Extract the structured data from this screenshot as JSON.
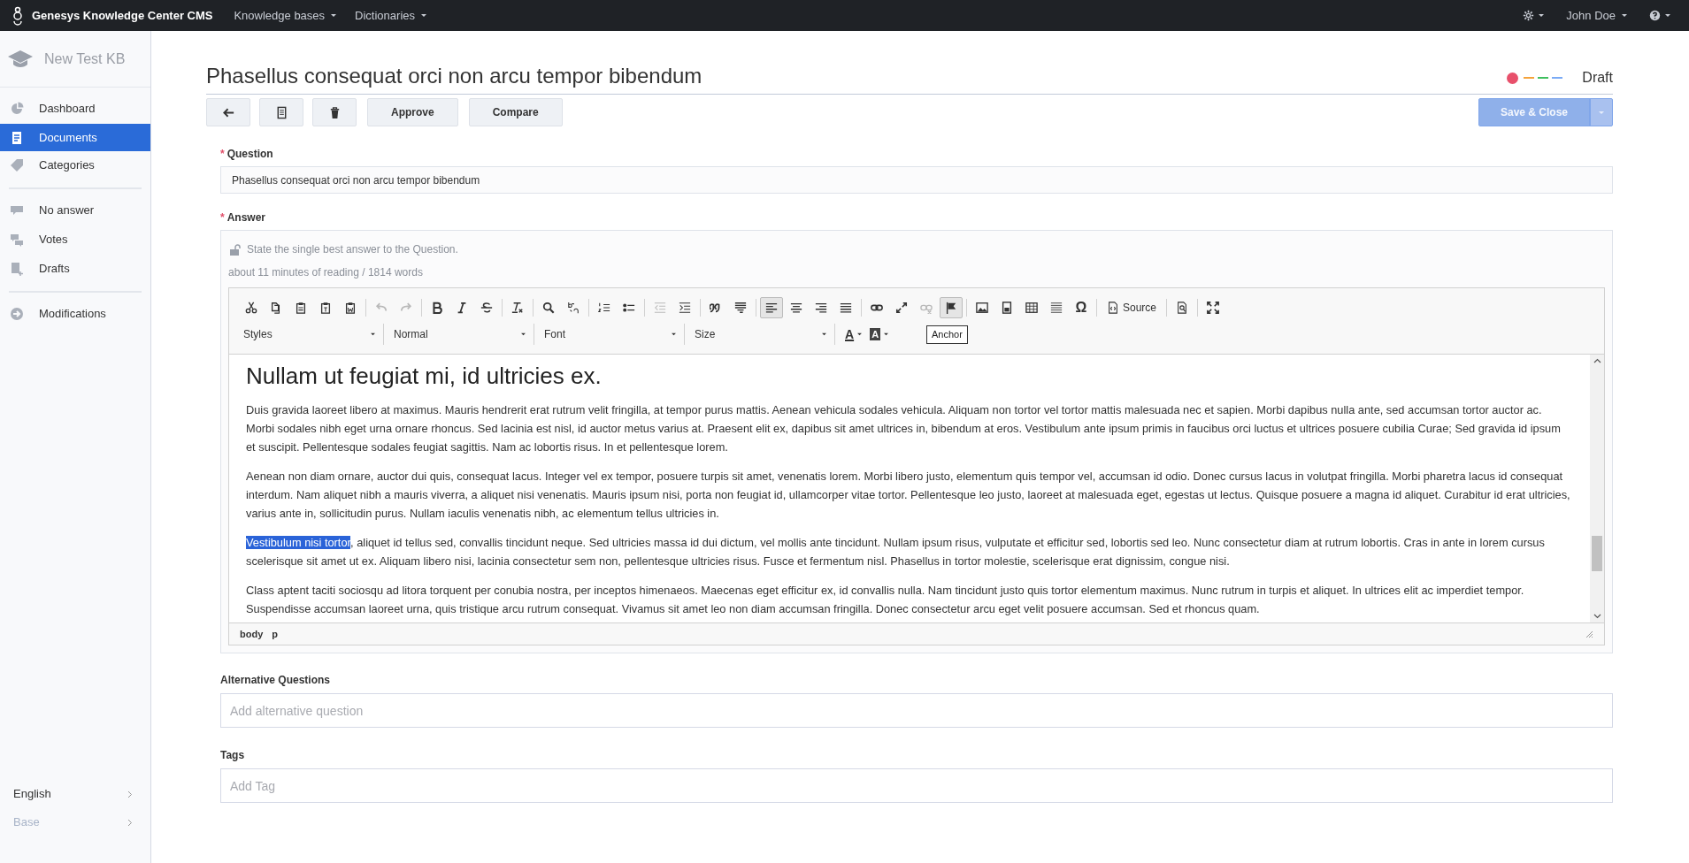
{
  "top_bar": {
    "app_title": "Genesys Knowledge Center CMS",
    "menus": [
      "Knowledge bases",
      "Dictionaries"
    ],
    "user": "John Doe"
  },
  "sidebar": {
    "kb_name": "New Test KB",
    "groups": [
      [
        {
          "label": "Dashboard",
          "selected": false
        },
        {
          "label": "Documents",
          "selected": true
        },
        {
          "label": "Categories",
          "selected": false
        }
      ],
      [
        {
          "label": "No answer",
          "selected": false
        },
        {
          "label": "Votes",
          "selected": false
        },
        {
          "label": "Drafts",
          "selected": false
        }
      ],
      [
        {
          "label": "Modifications",
          "selected": false
        }
      ]
    ],
    "footer": [
      {
        "label": "English",
        "disabled": false
      },
      {
        "label": "Base",
        "disabled": true
      }
    ]
  },
  "document": {
    "title": "Phasellus consequat orci non arcu tempor bibendum",
    "status": "Draft",
    "status_indicators": [
      {
        "kind": "dot",
        "color": "#e8506b"
      },
      {
        "kind": "dash",
        "color": "#f5a33b"
      },
      {
        "kind": "dash",
        "color": "#3fbf5f"
      },
      {
        "kind": "dash",
        "color": "#7aaaf5"
      }
    ],
    "actions": [
      "Approve",
      "Compare"
    ],
    "save_button": {
      "label": "Save & Close",
      "disabled": true
    }
  },
  "question": {
    "label": "Question",
    "required_mark": "*",
    "value": "Phasellus consequat orci non arcu tempor bibendum"
  },
  "answer": {
    "label": "Answer",
    "required_mark": "*",
    "hint": "State the single best answer to the Question.",
    "reading_info": "about 11 minutes of reading / 1814 words",
    "toolbar": [
      [
        {
          "disabled": false,
          "selected": false
        },
        {
          "disabled": false,
          "selected": false
        },
        {
          "disabled": false,
          "selected": false
        },
        {
          "disabled": false,
          "selected": false
        },
        {
          "disabled": false,
          "selected": false
        }
      ],
      [
        {
          "disabled": true,
          "selected": false
        },
        {
          "disabled": true,
          "selected": false
        }
      ],
      [
        {
          "disabled": false,
          "selected": false
        },
        {
          "disabled": false,
          "selected": false
        },
        {
          "disabled": false,
          "selected": false
        }
      ],
      [
        {
          "disabled": false,
          "selected": false
        }
      ],
      [
        {
          "disabled": false,
          "selected": false
        },
        {
          "disabled": false,
          "selected": false
        }
      ],
      [
        {
          "disabled": false,
          "selected": false
        },
        {
          "disabled": false,
          "selected": false
        }
      ],
      [
        {
          "disabled": true,
          "selected": false
        },
        {
          "disabled": false,
          "selected": false
        }
      ],
      [
        {
          "disabled": false,
          "selected": false
        },
        {
          "disabled": false,
          "selected": false
        }
      ],
      [
        {
          "disabled": false,
          "selected": true
        },
        {
          "disabled": false,
          "selected": false
        },
        {
          "disabled": false,
          "selected": false
        },
        {
          "disabled": false,
          "selected": false
        }
      ],
      [
        {
          "disabled": false,
          "selected": false
        },
        {
          "disabled": false,
          "selected": false
        },
        {
          "disabled": true,
          "selected": false
        },
        {
          "disabled": false,
          "selected": true
        }
      ],
      [
        {
          "disabled": false,
          "selected": false
        },
        {
          "disabled": false,
          "selected": false
        },
        {
          "disabled": false,
          "selected": false
        },
        {
          "disabled": false,
          "selected": false
        },
        {
          "disabled": false,
          "selected": false,
          "label": "Ω"
        }
      ],
      [
        {
          "disabled": false,
          "selected": false,
          "label": "Source"
        }
      ],
      [
        {
          "disabled": false,
          "selected": false
        }
      ],
      [
        {
          "disabled": false,
          "selected": false
        }
      ]
    ],
    "dropdowns": [
      "Styles",
      "Normal",
      "Font",
      "Size"
    ],
    "color_buttons": [
      "A",
      "A"
    ],
    "tooltip": "Anchor",
    "heading": "Nullam ut feugiat mi, id ultricies ex.",
    "paragraphs": [
      {
        "text": "Duis gravida laoreet libero at maximus. Mauris hendrerit erat rutrum velit fringilla, at tempor purus mattis. Aenean vehicula sodales vehicula. Aliquam non tortor vel tortor mattis malesuada nec et sapien. Morbi dapibus nulla ante, sed accumsan tortor auctor ac. Morbi sodales nibh eget urna ornare rhoncus. Sed lacinia est nisl, id auctor metus varius at. Praesent elit ex, dapibus sit amet ultrices in, bibendum at eros. Vestibulum ante ipsum primis in faucibus orci luctus et ultrices posuere cubilia Curae; Sed gravida id ipsum et suscipit. Pellentesque sodales feugiat sagittis. Nam ac lobortis risus. In et pellentesque lorem."
      },
      {
        "text": "Aenean non diam ornare, auctor dui quis, consequat lacus. Integer vel ex tempor, posuere turpis sit amet, venenatis lorem. Morbi libero justo, elementum quis tempor vel, accumsan id odio. Donec cursus lacus in volutpat fringilla. Morbi pharetra lacus id consequat interdum. Nam aliquet nibh a mauris viverra, a aliquet nisi venenatis. Mauris ipsum nisi, porta non feugiat id, ullamcorper vitae tortor. Pellentesque leo justo, laoreet at malesuada eget, egestas ut lectus. Quisque posuere a magna id aliquet. Curabitur id erat ultricies, varius ante in, sollicitudin purus. Nullam iaculis venenatis nibh, ac elementum tellus ultricies in."
      },
      {
        "selected_text": "Vestibulum nisi tortor",
        "text": ", aliquet id tellus sed, convallis tincidunt neque. Sed ultricies massa id dui dictum, vel mollis ante tincidunt. Nullam ipsum risus, vulputate et efficitur sed, lobortis sed leo. Nunc consectetur diam at rutrum lobortis. Cras in ante in lorem cursus scelerisque sit amet ut ex. Aliquam libero nisi, lacinia consectetur sem non, pellentesque ultricies risus. Fusce et fermentum nisl. Phasellus in tortor molestie, scelerisque erat dignissim, congue nisi."
      },
      {
        "text": "Class aptent taciti sociosqu ad litora torquent per conubia nostra, per inceptos himenaeos. Maecenas eget efficitur ex, id convallis nulla. Nam tincidunt justo quis tortor elementum maximus. Nunc rutrum in turpis et aliquet. In ultrices elit ac imperdiet tempor. Suspendisse accumsan laoreet urna, quis tristique arcu rutrum consequat. Vivamus sit amet leo non diam accumsan fringilla. Donec consectetur arcu eget velit posuere accumsan. Sed et rhoncus quam."
      }
    ],
    "path": [
      "body",
      "p"
    ]
  },
  "alternative_questions": {
    "label": "Alternative Questions",
    "placeholder": "Add alternative question"
  },
  "tags": {
    "label": "Tags",
    "placeholder": "Add Tag"
  }
}
